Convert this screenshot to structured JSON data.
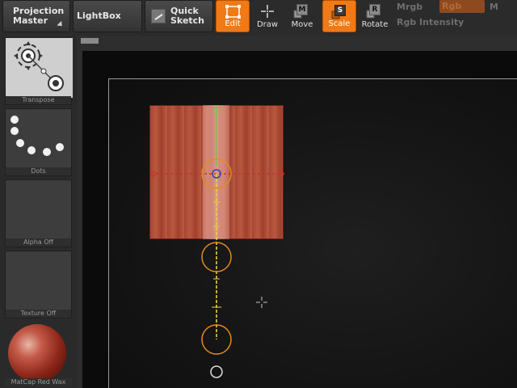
{
  "toolbar": {
    "projection_master_line1": "Projection",
    "projection_master_line2": "Master",
    "lightbox": "LightBox",
    "quick_sketch_line1": "Quick",
    "quick_sketch_line2": "Sketch",
    "tools": [
      {
        "label": "Edit",
        "key": "",
        "active": true,
        "icon": "edit-frame-icon"
      },
      {
        "label": "Draw",
        "key": "",
        "active": false,
        "icon": "draw-crosshair-icon"
      },
      {
        "label": "Move",
        "key": "M",
        "active": false,
        "icon": "move-icon"
      },
      {
        "label": "Scale",
        "key": "S",
        "active": true,
        "icon": "scale-icon"
      },
      {
        "label": "Rotate",
        "key": "R",
        "active": false,
        "icon": "rotate-icon"
      }
    ],
    "mrgb": "Mrgb",
    "rgb": "Rgb",
    "m": "M",
    "rgb_intensity": "Rgb Intensity"
  },
  "shelf": {
    "transpose": "Transpose",
    "dots": "Dots",
    "alpha": "Alpha Off",
    "texture": "Texture Off",
    "matcap": "MatCap Red Wax"
  },
  "colors": {
    "active_orange": "#f07a17",
    "mesh_red": "#b0503a",
    "transpose_line_yellow": "#e8d040",
    "transpose_ring_orange": "#e48a20"
  }
}
